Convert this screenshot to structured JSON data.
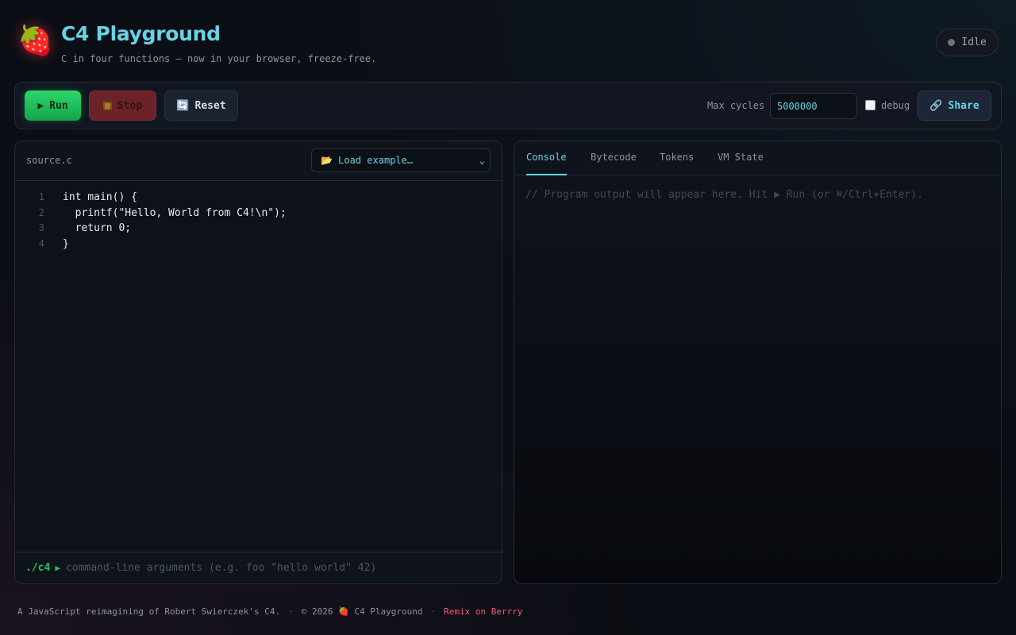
{
  "header": {
    "logo_emoji": "🍓",
    "title": "C4 Playground",
    "subtitle": "C in four functions — now in your browser, freeze-free.",
    "status": "Idle"
  },
  "toolbar": {
    "run_label": "Run",
    "run_icon": "▶",
    "stop_label": "Stop",
    "reset_label": "Reset",
    "reset_icon": "🔄",
    "max_cycles_label": "Max cycles",
    "max_cycles_value": "5000000",
    "debug_label": "debug",
    "debug_checked": false,
    "share_label": "Share",
    "share_icon": "🔗"
  },
  "editor": {
    "filename": "source.c",
    "example_select": "📂 Load example…",
    "lines": [
      {
        "num": "1",
        "code": "int main() {"
      },
      {
        "num": "2",
        "code": "  printf(\"Hello, World from C4!\\n\");"
      },
      {
        "num": "3",
        "code": "  return 0;"
      },
      {
        "num": "4",
        "code": "}"
      }
    ],
    "args_prompt": "./c4",
    "args_arrow": "▶",
    "args_placeholder": "command-line arguments  (e.g.  foo \"hello world\" 42)"
  },
  "output": {
    "tabs": [
      "Console",
      "Bytecode",
      "Tokens",
      "VM State"
    ],
    "active_tab": "Console",
    "console_placeholder": "// Program output will appear here. Hit ▶ Run (or ⌘/Ctrl+Enter)."
  },
  "footer": {
    "credit": "A JavaScript reimagining of Robert Swierczek's C4.",
    "sep": "·",
    "copyright": "© 2026 🍓 C4 Playground",
    "remix": "Remix on Berrry"
  },
  "colors": {
    "accent": "#67d3e6",
    "run_green": "#22c55e",
    "stop_red": "#6b2228",
    "remix_pink": "#f05a7a"
  }
}
